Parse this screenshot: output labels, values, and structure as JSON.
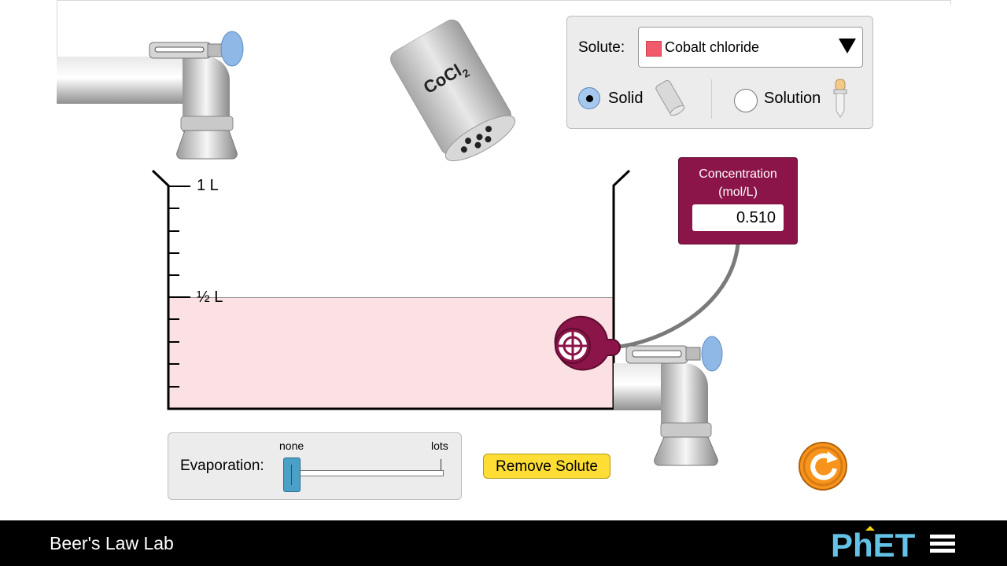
{
  "app": {
    "title": "Beer's Law Lab"
  },
  "beaker": {
    "label_full": "1 L",
    "label_half": "½ L",
    "solution_fraction": 0.5,
    "solution_color": "#fbe0e4"
  },
  "shaker": {
    "label": "CoCl",
    "subscript": "2"
  },
  "solute_panel": {
    "label": "Solute:",
    "selected": {
      "name": "Cobalt chloride",
      "color": "#f05a6a"
    },
    "form_options": [
      {
        "label": "Solid",
        "selected": true
      },
      {
        "label": "Solution",
        "selected": false
      }
    ]
  },
  "meter": {
    "title_line1": "Concentration",
    "title_line2": "(mol/L)",
    "value": "0.510"
  },
  "evaporation": {
    "label": "Evaporation:",
    "min_label": "none",
    "max_label": "lots",
    "level": 0
  },
  "buttons": {
    "remove_solute": "Remove Solute"
  },
  "icons": {
    "reset": "reset-arrow-icon",
    "menu": "hamburger-menu-icon",
    "logo": "phet-logo"
  },
  "colors": {
    "meter": "#8b1449",
    "remove_button": "#fedd34",
    "reset_button": "#f7941d",
    "solid_radio": "#a6c8ef"
  }
}
